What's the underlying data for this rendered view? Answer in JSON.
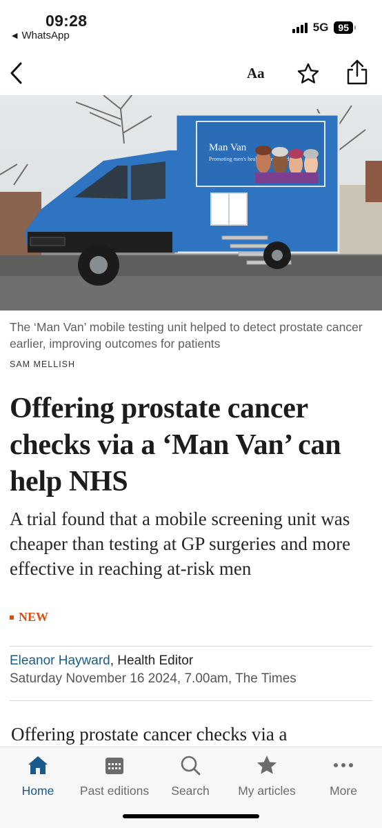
{
  "status": {
    "time": "09:28",
    "back_app": "WhatsApp",
    "network": "5G",
    "battery": "95"
  },
  "nav": {
    "font_size_label": "Aa",
    "icons": [
      "back-chevron-icon",
      "star-icon",
      "share-icon"
    ]
  },
  "hero": {
    "van_sign_title": "Man Van",
    "van_sign_subtitle": "Promoting men's health across London"
  },
  "article": {
    "caption": "The ‘Man Van’ mobile testing unit helped to detect prostate cancer earlier, improving outcomes for patients",
    "photo_credit": "SAM MELLISH",
    "headline": "Offering prostate cancer checks via a ‘Man Van’ can help NHS",
    "standfirst": "A trial found that a mobile screening unit was cheaper than testing at GP surgeries and more effective in reaching at-risk men",
    "badge": "NEW",
    "author": "Eleanor Hayward",
    "author_role": ", Health Editor",
    "dateline": "Saturday November 16 2024, 7.00am, The Times",
    "body_first_line": "Offering prostate cancer checks via a"
  },
  "tabs": [
    {
      "label": "Home",
      "icon": "home-icon",
      "active": true
    },
    {
      "label": "Past editions",
      "icon": "calendar-icon",
      "active": false
    },
    {
      "label": "Search",
      "icon": "search-icon",
      "active": false
    },
    {
      "label": "My articles",
      "icon": "star-icon",
      "active": false
    },
    {
      "label": "More",
      "icon": "more-dots-icon",
      "active": false
    }
  ],
  "colors": {
    "accent": "#1a5a8a",
    "badge": "#d94f12",
    "van_blue": "#2f74c0"
  }
}
